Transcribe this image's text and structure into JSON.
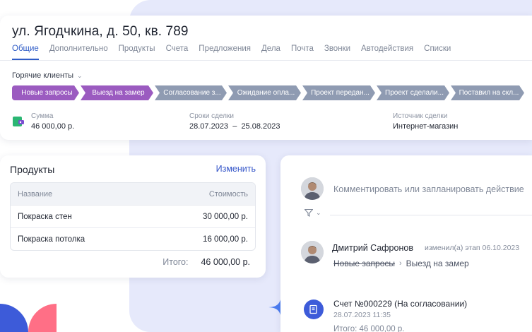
{
  "deal": {
    "title": "ул. Ягодчкина, д. 50, кв. 789",
    "tabs": [
      "Общие",
      "Дополнительно",
      "Продукты",
      "Счета",
      "Предложения",
      "Дела",
      "Почта",
      "Звонки",
      "Автодействия",
      "Списки"
    ],
    "active_tab": "Общие",
    "funnel": "Горячие клиенты",
    "stages": [
      {
        "label": "Новые запросы",
        "color": "#9b5bc0"
      },
      {
        "label": "Выезд на замер",
        "color": "#9b5bc0"
      },
      {
        "label": "Согласование з...",
        "color": "#8f9bb2"
      },
      {
        "label": "Ожидание опла...",
        "color": "#8f9bb2"
      },
      {
        "label": "Проект передан...",
        "color": "#8f9bb2"
      },
      {
        "label": "Проект сделали...",
        "color": "#8f9bb2"
      },
      {
        "label": "Поставил на скл...",
        "color": "#8f9bb2"
      }
    ],
    "sum_label": "Сумма",
    "sum_value": "46 000,00 р.",
    "dates_label": "Сроки сделки",
    "dates_from": "28.07.2023",
    "dates_sep": "–",
    "dates_to": "25.08.2023",
    "source_label": "Источник сделки",
    "source_value": "Интернет-магазин"
  },
  "products": {
    "title": "Продукты",
    "edit_label": "Изменить",
    "col_name": "Название",
    "col_price": "Стоимость",
    "rows": [
      {
        "name": "Покраска стен",
        "price": "30 000,00 р."
      },
      {
        "name": "Покраска потолка",
        "price": "16 000,00 р."
      }
    ],
    "total_label": "Итого:",
    "total_value": "46 000,00 р."
  },
  "timeline": {
    "comment_placeholder": "Комментировать или запланировать действие",
    "event": {
      "author": "Дмитрий Сафронов",
      "action": "изменил(а) этап",
      "date": "06.10.2023",
      "from_stage": "Новые запросы",
      "to_stage": "Выезд на замер"
    },
    "invoice": {
      "title": "Счет №000229 (На согласовании)",
      "datetime": "28.07.2023 11:35",
      "total": "Итого: 46 000,00 р."
    }
  },
  "colors": {
    "accent": "#2f5cc7",
    "stage_done": "#9b5bc0",
    "stage_todo": "#8f9bb2",
    "background_panel": "#e6e9fb"
  }
}
